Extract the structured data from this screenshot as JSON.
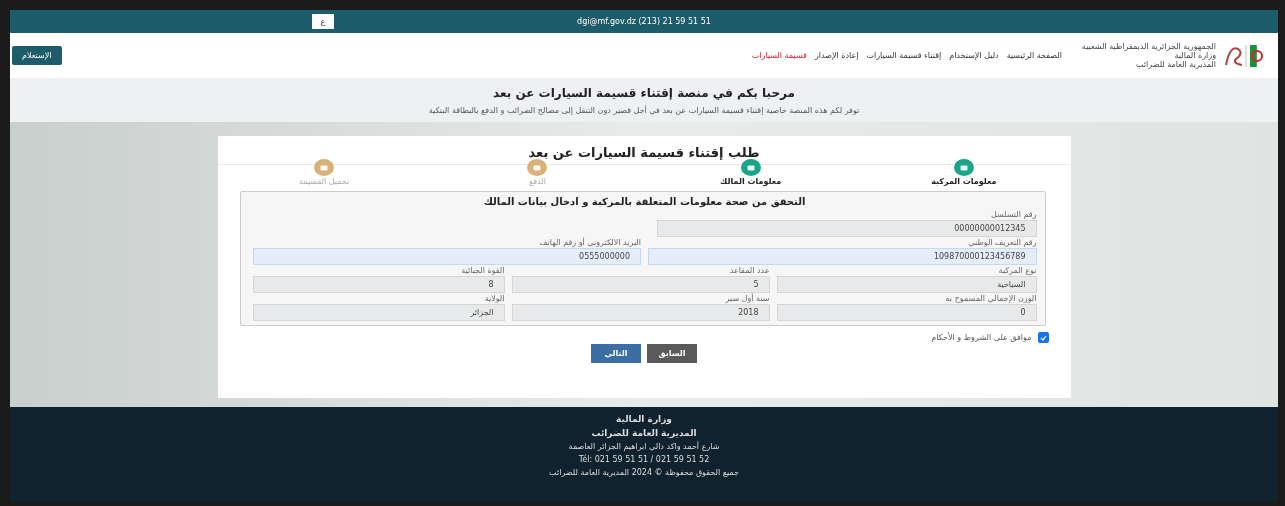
{
  "top_bar": {
    "language_button": "ع",
    "contact": "dgi@mf.gov.dz  (213) 21 59 51 51"
  },
  "header": {
    "logo_lines": [
      "الجمهورية الجزائرية الديمقراطية الشعبية",
      "وزارة المالية",
      "المديرية العامة للضرائب"
    ],
    "nav": [
      {
        "label": "الصفحة الرئيسية",
        "selected": false
      },
      {
        "label": "دليل الإستخدام",
        "selected": false
      },
      {
        "label": "إقتناء قسيمة السيارات",
        "selected": false
      },
      {
        "label": "إعادة الإصدار",
        "selected": false
      },
      {
        "label": "قسيمة السيارات",
        "selected": true
      }
    ],
    "action_button": "الإستعلام"
  },
  "banner": {
    "title": "مرحبا بكم في منصة إقتناء قسيمة السيارات عن بعد",
    "subtitle": "توفر لكم هذه المنصة خاصية إقتناء قسيمة السيارات عن بعد في أجل قصير دون التنقل إلى مصالح الضرائب و الدفع بالبطاقة البنكية"
  },
  "card": {
    "title": "طلب إقتناء قسيمة السيارات عن بعد",
    "steps": [
      {
        "label": "معلومات المركبة",
        "done": true
      },
      {
        "label": "معلومات المالك",
        "done": true
      },
      {
        "label": "الدفع",
        "done": false
      },
      {
        "label": "تحميل القسيمة",
        "done": false
      }
    ],
    "section_title": "التحقق من صحة معلومات المتعلقة بالمركبة و ادخال بيانات المالك",
    "rows": [
      [
        {
          "label": "رقم التسلسل",
          "value": "00000000012345",
          "editable": false
        }
      ],
      [
        {
          "label": "رقم التعريف الوطني",
          "value": "109870000123456789",
          "editable": true
        },
        {
          "label": "البريد الالكتروني أو رقم الهاتف",
          "value": "0555000000",
          "editable": true
        }
      ],
      [
        {
          "label": "نوع المركبة",
          "value": "السياحية",
          "editable": false
        },
        {
          "label": "عدد المقاعد",
          "value": "5",
          "editable": false
        },
        {
          "label": "القوة الجبائية",
          "value": "8",
          "editable": false
        }
      ],
      [
        {
          "label": "الوزن الإجمالي المسموح به",
          "value": "0",
          "editable": false
        },
        {
          "label": "سنة أول سير",
          "value": "2018",
          "editable": false
        },
        {
          "label": "الولاية",
          "value": "الجزائر",
          "editable": false
        }
      ]
    ],
    "agree": {
      "label": "موافق على الشروط و الأحكام",
      "checked": true
    },
    "buttons": [
      {
        "label": "السابق",
        "kind": "secondary"
      },
      {
        "label": "التالي",
        "kind": "primary"
      }
    ]
  },
  "footer": {
    "lines": [
      "وزارة المالية",
      "المديرية العامة للضرائب",
      "شارع أحمد واكد دالي ابراهيم الجزائر العاصمة",
      "Tél: 021 59 51 51 / 021 59 51 52",
      "جميع الحقوق محفوظة © 2024 المديرية العامة للضرائب"
    ]
  }
}
